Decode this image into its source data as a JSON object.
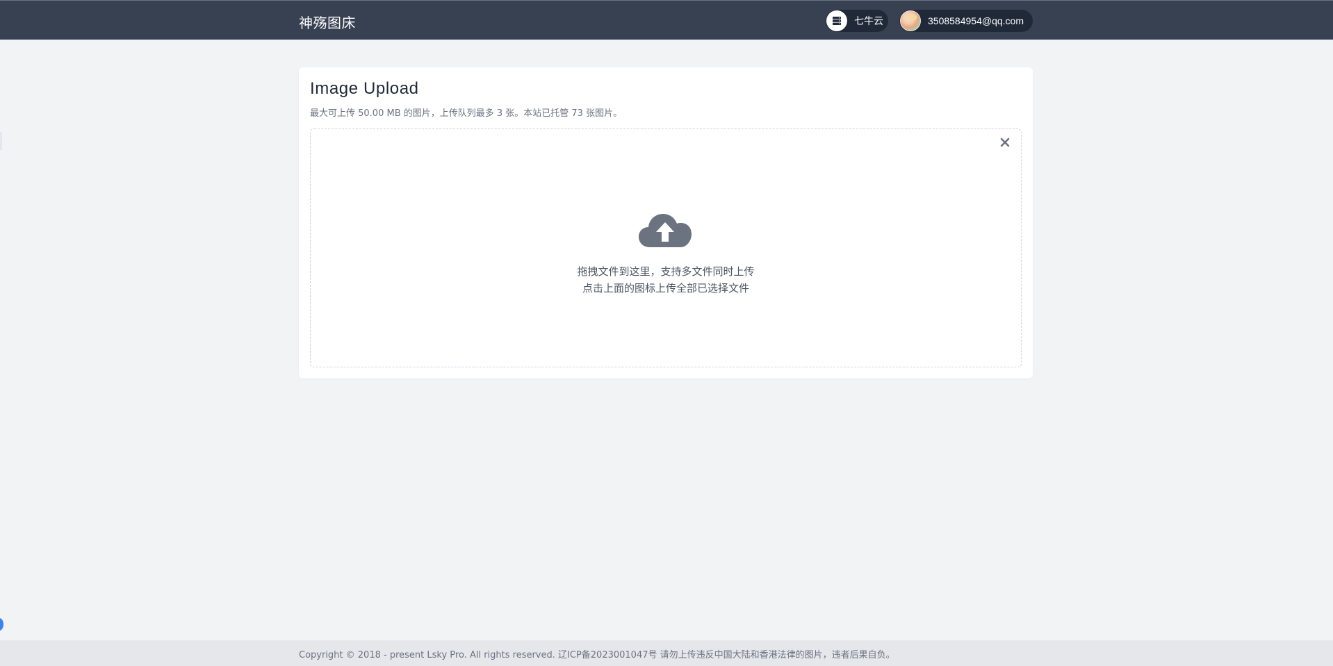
{
  "header": {
    "brand": "神殇图床",
    "storage": {
      "label": "七牛云",
      "icon": "server-icon"
    },
    "user": {
      "email": "3508584954@qq.com",
      "icon": "avatar"
    }
  },
  "upload": {
    "title": "Image Upload",
    "subtitle": "最大可上传 50.00 MB 的图片，上传队列最多 3 张。本站已托管 73 张图片。",
    "hint_line1": "拖拽文件到这里，支持多文件同时上传",
    "hint_line2": "点击上面的图标上传全部已选择文件",
    "upload_icon": "cloud-upload-icon",
    "clear_icon": "close-icon"
  },
  "footer": {
    "text": "Copyright © 2018 - present Lsky Pro. All rights reserved.  辽ICP备2023001047号 请勿上传违反中国大陆和香港法律的图片，违者后果自负。"
  },
  "colors": {
    "header_bg": "#374151",
    "pill_bg": "#1f2937",
    "page_bg": "#f2f3f5",
    "icon_gray": "#6b7280"
  }
}
